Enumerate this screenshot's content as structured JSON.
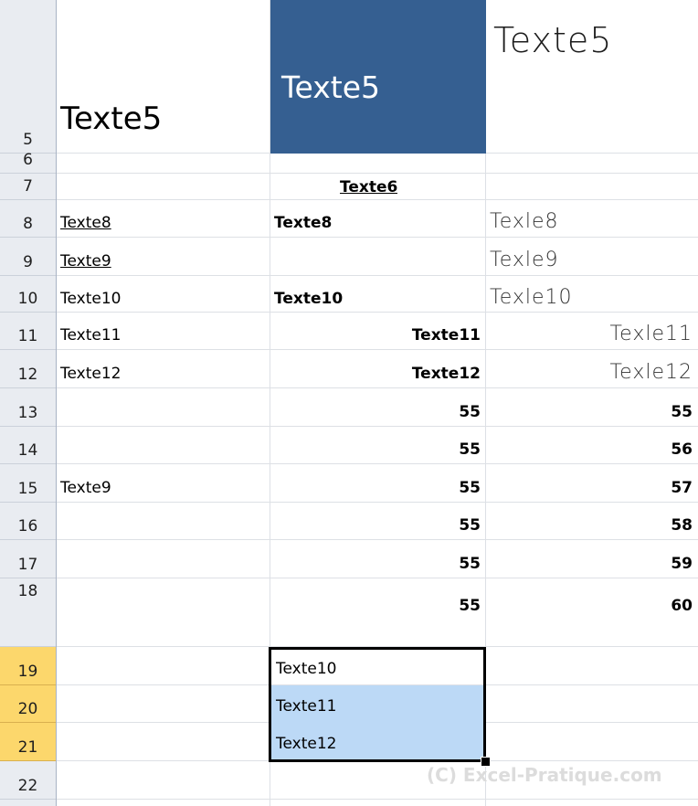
{
  "rows": {
    "r5": {
      "num": "5",
      "b": "Texte5",
      "c": "Texte5",
      "d": "Texte5"
    },
    "r6": {
      "num": "6"
    },
    "r7": {
      "num": "7",
      "c": "Texte6"
    },
    "r8": {
      "num": "8",
      "b": "Texte8",
      "c": "Texte8",
      "d": "Texle8"
    },
    "r9": {
      "num": "9",
      "b": "Texte9",
      "d": "Texle9"
    },
    "r10": {
      "num": "10",
      "b": "Texte10",
      "c": "Texte10",
      "d": "Texle10"
    },
    "r11": {
      "num": "11",
      "b": "Texte11",
      "c": "Texte11",
      "d": "Texle11"
    },
    "r12": {
      "num": "12",
      "b": "Texte12",
      "c": "Texte12",
      "d": "Texle12"
    },
    "r13": {
      "num": "13",
      "c": "55",
      "d": "55"
    },
    "r14": {
      "num": "14",
      "c": "55",
      "d": "56"
    },
    "r15": {
      "num": "15",
      "b": "Texte9",
      "c": "55",
      "d": "57"
    },
    "r16": {
      "num": "16",
      "c": "55",
      "d": "58"
    },
    "r17": {
      "num": "17",
      "c": "55",
      "d": "59"
    },
    "r18": {
      "num": "18",
      "c": "55",
      "d": "60"
    },
    "r19": {
      "num": "19",
      "c": "Texte10"
    },
    "r20": {
      "num": "20",
      "c": "Texte11"
    },
    "r21": {
      "num": "21",
      "c": "Texte12"
    },
    "r22": {
      "num": "22"
    }
  },
  "colors": {
    "header_fill": "#355f91",
    "selected_row_header": "#fcd76c",
    "selection_fill": "#bcd9f6"
  },
  "watermark": "(C) Excel-Pratique.com"
}
